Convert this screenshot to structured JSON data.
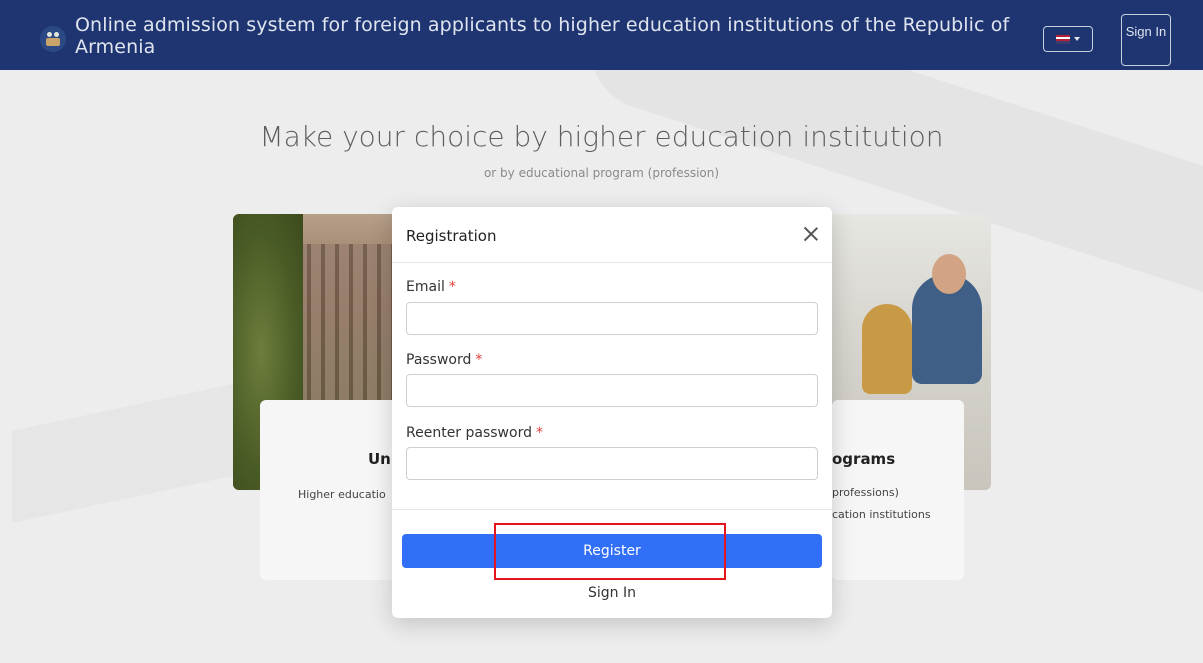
{
  "header": {
    "title": "Online admission system for foreign applicants to higher education institutions of the Republic of Armenia",
    "language": "en-US",
    "signin_label": "Sign In"
  },
  "page": {
    "headline": "Make your choice by higher education institution",
    "subheadline": "or by educational program (profession)",
    "card_left": {
      "title_visible": "Un",
      "desc_visible": "Higher educatio"
    },
    "card_right": {
      "title_visible": "ograms",
      "desc_line1_visible": "professions)",
      "desc_line2_visible": "cation institutions"
    }
  },
  "modal": {
    "title": "Registration",
    "email_label": "Email",
    "password_label": "Password",
    "reenter_label": "Reenter password",
    "required_mark": "*",
    "email_value": "",
    "password_value": "",
    "reenter_value": "",
    "register_label": "Register",
    "signin_link": "Sign In"
  },
  "colors": {
    "header_bg": "#1e3571",
    "primary_button": "#3170f6",
    "highlight": "#e4161d",
    "required": "#e2413b"
  }
}
